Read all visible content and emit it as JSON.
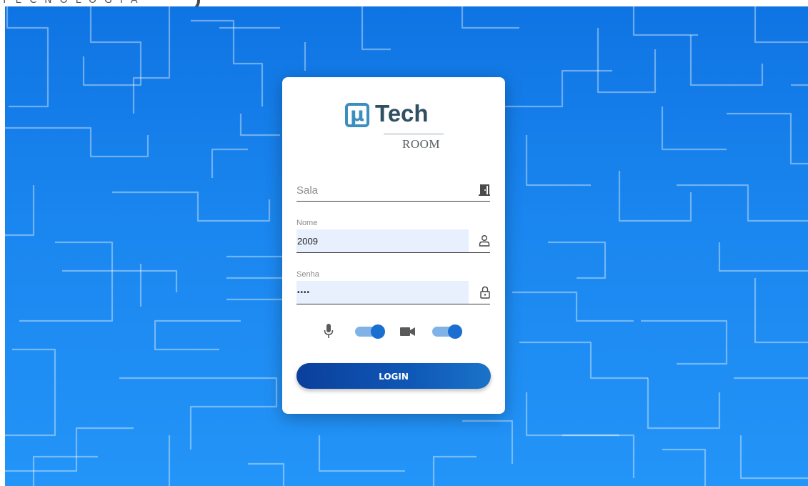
{
  "header": {
    "brand_tagline": "TECNOLOGIA"
  },
  "logo": {
    "mark": "µ",
    "word": "Tech",
    "subtitle": "ROOM"
  },
  "form": {
    "room": {
      "placeholder": "Sala",
      "icon": "door-icon"
    },
    "name": {
      "label": "Nome",
      "value": "2009",
      "icon": "user-icon"
    },
    "password": {
      "label": "Senha",
      "masked_value": "••••",
      "icon": "lock-icon"
    }
  },
  "media": {
    "microphone": {
      "icon": "microphone-icon",
      "enabled": true
    },
    "camera": {
      "icon": "video-camera-icon",
      "enabled": true
    }
  },
  "actions": {
    "login_label": "LOGIN"
  },
  "colors": {
    "background_top": "#0f74e3",
    "background_bottom": "#2394f8",
    "logo_accent": "#3a8fc0",
    "toggle_track": "#7fb3e6",
    "toggle_knob": "#1a6fd1",
    "button_start": "#0b3f9c",
    "button_end": "#1a73c8",
    "input_fill": "#e8f0fe"
  }
}
